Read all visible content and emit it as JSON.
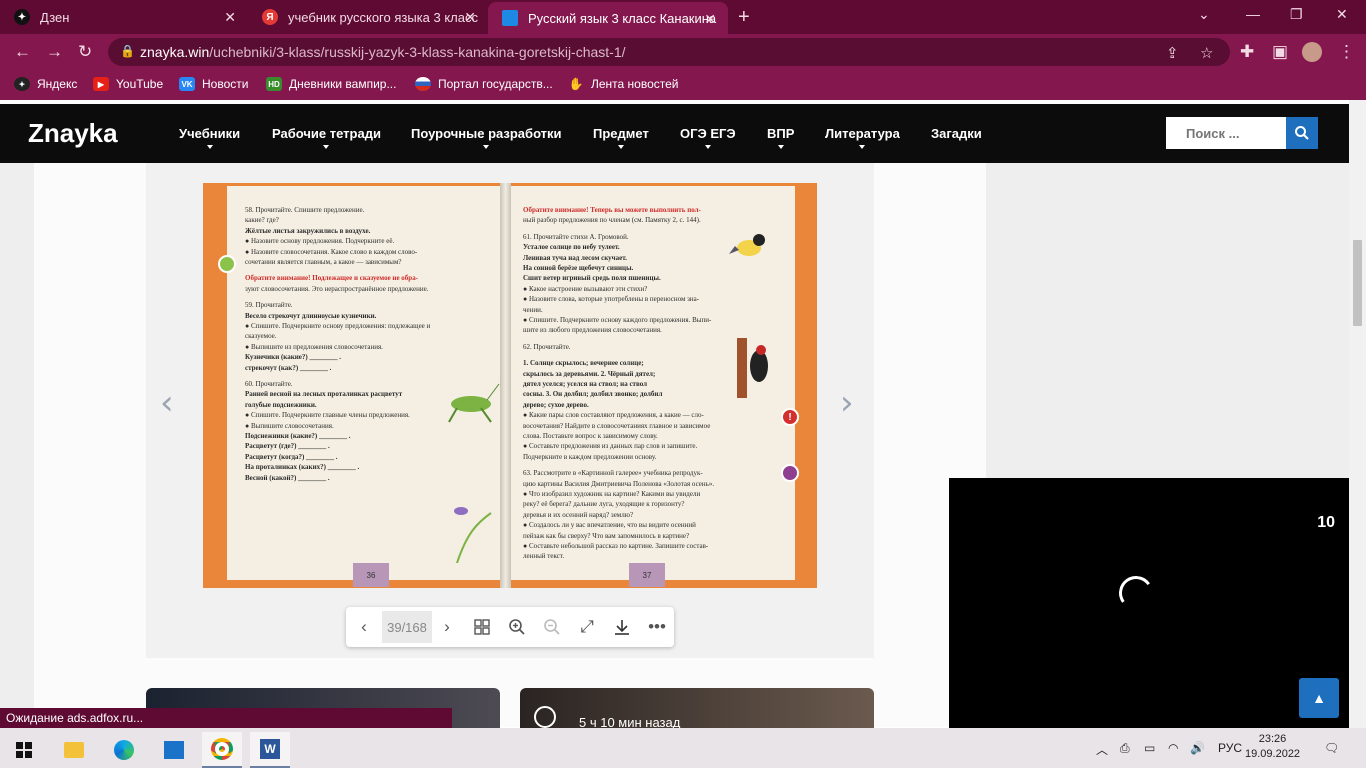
{
  "tabs": [
    {
      "title": "Дзен",
      "active": false
    },
    {
      "title": "учебник русского языка 3 класс",
      "active": false
    },
    {
      "title": "Русский язык 3 класс Канакина",
      "active": true
    }
  ],
  "address": {
    "host": "znayka.win",
    "path": "/uchebniki/3-klass/russkij-yazyk-3-klass-kanakina-goretskij-chast-1/"
  },
  "bookmarks": [
    {
      "label": "Яндекс",
      "color": "#222222"
    },
    {
      "label": "YouTube",
      "color": "#e62117"
    },
    {
      "label": "Новости",
      "color": "#333333"
    },
    {
      "label": "Дневники вампир...",
      "color": "#3a8b2b"
    },
    {
      "label": "Портал государств...",
      "color": "#2f63c0"
    },
    {
      "label": "Лента новостей",
      "color": "#555555"
    }
  ],
  "site": {
    "logo": "Znayka",
    "menu": [
      "Учебники",
      "Рабочие тетради",
      "Поурочные разработки",
      "Предмет",
      "ОГЭ ЕГЭ",
      "ВПР",
      "Литература",
      "Загадки"
    ],
    "search_placeholder": "Поиск ..."
  },
  "book": {
    "left_page": {
      "page_number": "36",
      "lines": [
        {
          "text": "58. Прочитайте. Спишите предложение.",
          "style": "normal"
        },
        {
          "text": "какие?                    где?",
          "style": "normal"
        },
        {
          "text": "Жёлтые листья закружились в воздухе.",
          "style": "bold"
        },
        {
          "text": "● Назовите основу предложения. Подчеркните её.",
          "style": "normal"
        },
        {
          "text": "● Назовите словосочетания. Какое слово в каждом слово-",
          "style": "normal"
        },
        {
          "text": "сочетании является главным, а какое — зависимым?",
          "style": "normal"
        },
        {
          "text": "Обратите внимание! Подлежащее и сказуемое не обра-",
          "style": "red"
        },
        {
          "text": "зуют словосочетания. Это нераспространённое предложение.",
          "style": "normal"
        },
        {
          "text": "59. Прочитайте.",
          "style": "normal"
        },
        {
          "text": "Весело стрекочут длинноусые кузнечики.",
          "style": "bold"
        },
        {
          "text": "● Спишите. Подчеркните основу предложения: подлежащее и",
          "style": "normal"
        },
        {
          "text": "сказуемое.",
          "style": "normal"
        },
        {
          "text": "● Выпишите из предложения словосочетания.",
          "style": "normal"
        },
        {
          "text": "Кузнечики (какие?) ________ .",
          "style": "bold"
        },
        {
          "text": "стрекочут (как?) ________ .",
          "style": "bold"
        },
        {
          "text": "60. Прочитайте.",
          "style": "normal"
        },
        {
          "text": "Ранней весной на лесных проталинках расцветут",
          "style": "bold"
        },
        {
          "text": "голубые подснежники.",
          "style": "bold"
        },
        {
          "text": "● Спишите. Подчеркните главные члены предложения.",
          "style": "normal"
        },
        {
          "text": "● Выпишите словосочетания.",
          "style": "normal"
        },
        {
          "text": "Подснежники (какие?) ________ .",
          "style": "bold"
        },
        {
          "text": "Расцветут (где?) ________ .",
          "style": "bold"
        },
        {
          "text": "Расцветут (когда?) ________ .",
          "style": "bold"
        },
        {
          "text": "На проталинках (каких?) ________ .",
          "style": "bold"
        },
        {
          "text": "Весной (какой?) ________ .",
          "style": "bold"
        }
      ]
    },
    "right_page": {
      "page_number": "37",
      "lines": [
        {
          "text": "Обратите внимание! Теперь вы можете выполнить пол-",
          "style": "red"
        },
        {
          "text": "ный разбор предложения по членам (см. Памятку 2, с. 144).",
          "style": "normal"
        },
        {
          "text": "61. Прочитайте стихи А. Громовой.",
          "style": "normal"
        },
        {
          "text": "Усталое солнце по небу тулеет.",
          "style": "bold"
        },
        {
          "text": "Ленивая туча над лесом скучает.",
          "style": "bold"
        },
        {
          "text": "На сонной берёзе щебечут синицы.",
          "style": "bold"
        },
        {
          "text": "Сшит ветер игривый средь поля пшеницы.",
          "style": "bold"
        },
        {
          "text": "● Какое настроение вызывают эти стихи?",
          "style": "normal"
        },
        {
          "text": "● Назовите слова, которые употреблены в переносном зна-",
          "style": "normal"
        },
        {
          "text": "чении.",
          "style": "normal"
        },
        {
          "text": "● Спишите. Подчеркните основу каждого предложения. Выпи-",
          "style": "normal"
        },
        {
          "text": "шите из любого предложения словосочетания.",
          "style": "normal"
        },
        {
          "text": "62. Прочитайте.",
          "style": "normal"
        },
        {
          "text": "1. Солнце скрылось; вечернее солнце;",
          "style": "bold"
        },
        {
          "text": "скрылось за деревьями. 2. Чёрный дятел;",
          "style": "bold"
        },
        {
          "text": "дятел уселся; уселся на ствол; на ствол",
          "style": "bold"
        },
        {
          "text": "сосны. 3. Он долбил; долбил звонко; долбил",
          "style": "bold"
        },
        {
          "text": "дерево; сухое дерево.",
          "style": "bold"
        },
        {
          "text": "● Какие пары слов составляют предложения, а какие — сло-",
          "style": "normal"
        },
        {
          "text": "восочетания? Найдите в словосочетаниях главное и зависимое",
          "style": "normal"
        },
        {
          "text": "слова. Поставьте вопрос к зависимому слову.",
          "style": "normal"
        },
        {
          "text": "● Составьте предложения из данных пар слов и запишите.",
          "style": "normal"
        },
        {
          "text": "Подчеркните в каждом предложении основу.",
          "style": "normal"
        },
        {
          "text": "63. Рассмотрите в «Картинной галерее» учебника репродук-",
          "style": "normal"
        },
        {
          "text": "цию картины Василия Дмитриевича Поленова «Золотая осень».",
          "style": "normal"
        },
        {
          "text": "● Что изобразил художник на картине? Какими вы увидели",
          "style": "normal"
        },
        {
          "text": "реку? её берега? дальние луга, уходящие к горизонту?",
          "style": "normal"
        },
        {
          "text": "деревья и их осенний наряд? землю?",
          "style": "normal"
        },
        {
          "text": "● Создалось ли у вас впечатление, что вы видите осенний",
          "style": "normal"
        },
        {
          "text": "пейзаж как бы сверху? Что вам запомнилось в картине?",
          "style": "normal"
        },
        {
          "text": "● Составьте небольшой рассказ по картине. Запишите состав-",
          "style": "normal"
        },
        {
          "text": "ленный текст.",
          "style": "normal"
        }
      ]
    }
  },
  "viewer": {
    "page_indicator": "39/168"
  },
  "cards": [
    {
      "label": ""
    },
    {
      "label": "5 ч 10 мин назад"
    }
  ],
  "video": {
    "countdown": "10"
  },
  "status_text": "Ожидание ads.adfox.ru...",
  "taskbar": {
    "language": "РУС",
    "time": "23:26",
    "date": "19.09.2022"
  },
  "colors": {
    "browser_frame": "#84184e",
    "tab_strip": "#5e0a33",
    "site_header": "#0c0c0c",
    "accent": "#1f6fbf",
    "book_cover": "#e9863a"
  }
}
